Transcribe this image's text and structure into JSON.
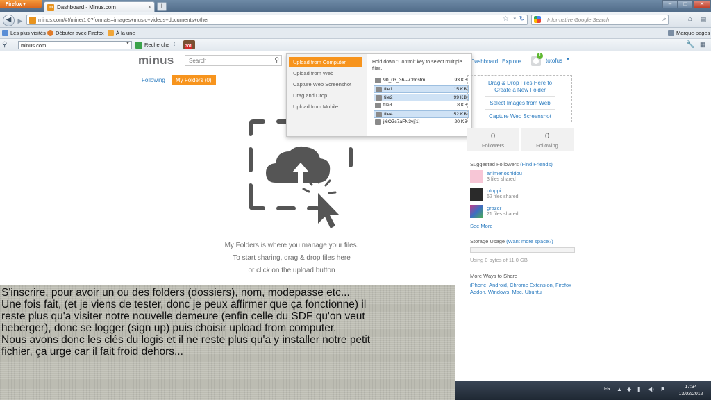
{
  "browser": {
    "menu_button": "Firefox",
    "tab_title": "Dashboard - Minus.com",
    "new_tab": "+",
    "url": "minus.com/#!/mine/1.0?formats=images+music+videos+documents+other",
    "search_placeholder": "Informative Google Search",
    "bookmarks": [
      "Les plus visités",
      "Débuter avec Firefox",
      "À la une"
    ],
    "bookmarks_menu": "Marque-pages",
    "addon_search_value": "minus.com",
    "addon_search_label": "Recherche",
    "addon_badge": "301"
  },
  "page": {
    "logo": "minus",
    "search_placeholder": "Search",
    "nav": {
      "dashboard": "Dashboard",
      "explore": "Explore"
    },
    "user": {
      "name": "totofus",
      "notifications": "1"
    },
    "tabs": {
      "following": "Following",
      "my_folders": "My Folders (0)"
    },
    "empty_state": [
      "My Folders is where you manage your files.",
      "To start sharing, drag & drop files here",
      "or click on the upload button"
    ]
  },
  "upload_menu": {
    "items": [
      "Upload from Computer",
      "Upload from Web",
      "Capture Web Screenshot",
      "Drag and Drop!",
      "Upload from Mobile"
    ],
    "active_index": 0,
    "hint": "Hold down \"Control\" key to select multiple files.",
    "files": [
      {
        "name": "90_03_36---Christm...",
        "size": "93 KB",
        "selected": false
      },
      {
        "name": "file1",
        "size": "15 KB",
        "selected": true
      },
      {
        "name": "file2",
        "size": "99 KB",
        "selected": true
      },
      {
        "name": "file3",
        "size": "8 KB",
        "selected": false
      },
      {
        "name": "file4",
        "size": "52 KB",
        "selected": true
      },
      {
        "name": "ji6OZc7aFN3yj[1]",
        "size": "20 KB",
        "selected": false
      }
    ]
  },
  "sidebar": {
    "drop_zone": {
      "line1": "Drag & Drop Files Here to",
      "line2": "Create a New Folder",
      "select_web": "Select Images from Web",
      "capture": "Capture Web Screenshot"
    },
    "followers": {
      "count": "0",
      "label": "Followers"
    },
    "following": {
      "count": "0",
      "label": "Following"
    },
    "suggested_title": "Suggested Followers",
    "find_friends": "(Find Friends)",
    "suggested": [
      {
        "name": "animenoshidou",
        "files": "3 files shared"
      },
      {
        "name": "utoppi",
        "files": "62 files shared"
      },
      {
        "name": "grazer",
        "files": "21 files shared"
      }
    ],
    "see_more": "See More",
    "storage_title": "Storage Usage",
    "storage_more": "(Want more space?)",
    "storage_used_fraction": 0,
    "storage_text": "Using 0 bytes of 11.0 GB",
    "ways_title": "More Ways to Share",
    "ways_links": "iPhone, Android, Chrome Extension, Firefox Addon, Windows, Mac, Ubuntu"
  },
  "caption": [
    "S'inscrire, pour avoir un ou des folders (dossiers), nom, modepasse etc...",
    "Une fois fait, (et je viens de tester, donc je peux affirmer que ça fonctionne) il",
    "reste plus qu'a visiter notre nouvelle demeure (enfin celle du SDF qu'on veut",
    "heberger), donc se logger (sign up) puis choisir upload from computer.",
    "Nous avons donc les clés du logis et il ne reste plus qu'a y installer notre petit",
    "fichier, ça urge car il fait froid dehors..."
  ],
  "taskbar": {
    "lang": "FR",
    "time": "17:34",
    "date": "13/02/2012"
  },
  "colors": {
    "accent": "#f7941d",
    "link": "#2b7bbf",
    "logo": "#6d6e71"
  }
}
